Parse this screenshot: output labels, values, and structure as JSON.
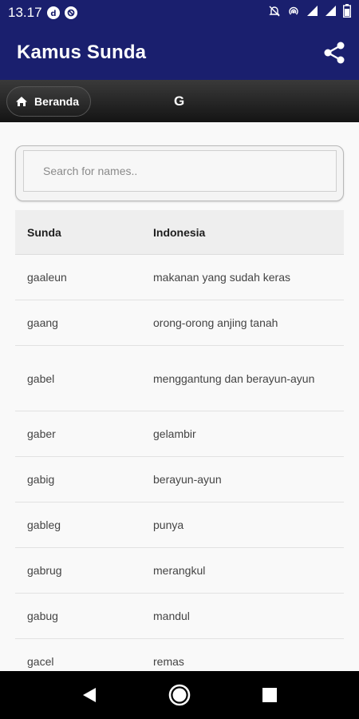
{
  "status_bar": {
    "time": "13.17",
    "icons": [
      "notification-d-icon",
      "notification-circle-icon",
      "mute-icon",
      "hotspot-icon",
      "wifi-icon",
      "signal-icon",
      "battery-icon"
    ]
  },
  "app_bar": {
    "title": "Kamus Sunda",
    "share_icon": "share-icon"
  },
  "sub_bar": {
    "home_label": "Beranda",
    "home_icon": "home-icon",
    "title": "G"
  },
  "search": {
    "placeholder": "Search for names..",
    "value": ""
  },
  "table": {
    "headers": [
      "Sunda",
      "Indonesia"
    ],
    "rows": [
      {
        "sunda": "gaaleun",
        "indonesia": "makanan yang sudah keras"
      },
      {
        "sunda": "gaang",
        "indonesia": "orong-orong anjing tanah"
      },
      {
        "sunda": "gabel",
        "indonesia": "menggantung dan berayun-ayun"
      },
      {
        "sunda": "gaber",
        "indonesia": "gelambir"
      },
      {
        "sunda": "gabig",
        "indonesia": "berayun-ayun"
      },
      {
        "sunda": "gableg",
        "indonesia": "punya"
      },
      {
        "sunda": "gabrug",
        "indonesia": "merangkul"
      },
      {
        "sunda": "gabug",
        "indonesia": "mandul"
      },
      {
        "sunda": "gacel",
        "indonesia": "remas"
      }
    ]
  },
  "colors": {
    "primary": "#1a1f6e",
    "sub_bar": "#1e1e1e",
    "header_bg": "#eeeeee",
    "body_bg": "#f9f9f9"
  },
  "nav_bar": {
    "icons": [
      "back-icon",
      "home-circle-icon",
      "recents-icon"
    ]
  }
}
